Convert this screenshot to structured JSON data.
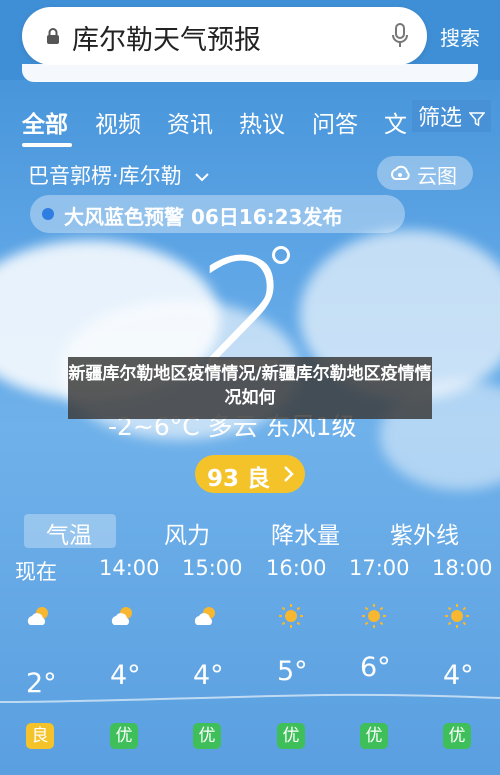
{
  "search": {
    "query": "库尔勒天气预报",
    "button_label": "搜索"
  },
  "tabs": [
    {
      "label": "全部"
    },
    {
      "label": "视频"
    },
    {
      "label": "资讯"
    },
    {
      "label": "热议"
    },
    {
      "label": "问答"
    },
    {
      "label": "文"
    }
  ],
  "filter_label": "筛选",
  "location": "巴音郭楞·库尔勒",
  "cloud_map_label": "云图",
  "alert": "大风蓝色预警 06日16:23发布",
  "current": {
    "temp": "2",
    "summary": "-2~6°C 多云 东风1级"
  },
  "overlay_caption": "新疆库尔勒地区疫情情况/新疆库尔勒地区疫情情况如何",
  "aqi_label": "93 良",
  "subtabs": [
    {
      "label": "气温"
    },
    {
      "label": "风力"
    },
    {
      "label": "降水量"
    },
    {
      "label": "紫外线"
    }
  ],
  "hourly": [
    {
      "time": "现在",
      "icon": "partly-cloudy-icon",
      "temp": "2°",
      "aq": "良",
      "aq_color": "#f4c32a"
    },
    {
      "time": "14:00",
      "icon": "partly-cloudy-icon",
      "temp": "4°",
      "aq": "优",
      "aq_color": "#3fbf5a"
    },
    {
      "time": "15:00",
      "icon": "partly-cloudy-icon",
      "temp": "4°",
      "aq": "优",
      "aq_color": "#3fbf5a"
    },
    {
      "time": "16:00",
      "icon": "sun-icon",
      "temp": "5°",
      "aq": "优",
      "aq_color": "#3fbf5a"
    },
    {
      "time": "17:00",
      "icon": "sun-icon",
      "temp": "6°",
      "aq": "优",
      "aq_color": "#3fbf5a"
    },
    {
      "time": "18:00",
      "icon": "sun-icon",
      "temp": "4°",
      "aq": "优",
      "aq_color": "#3fbf5a"
    }
  ]
}
